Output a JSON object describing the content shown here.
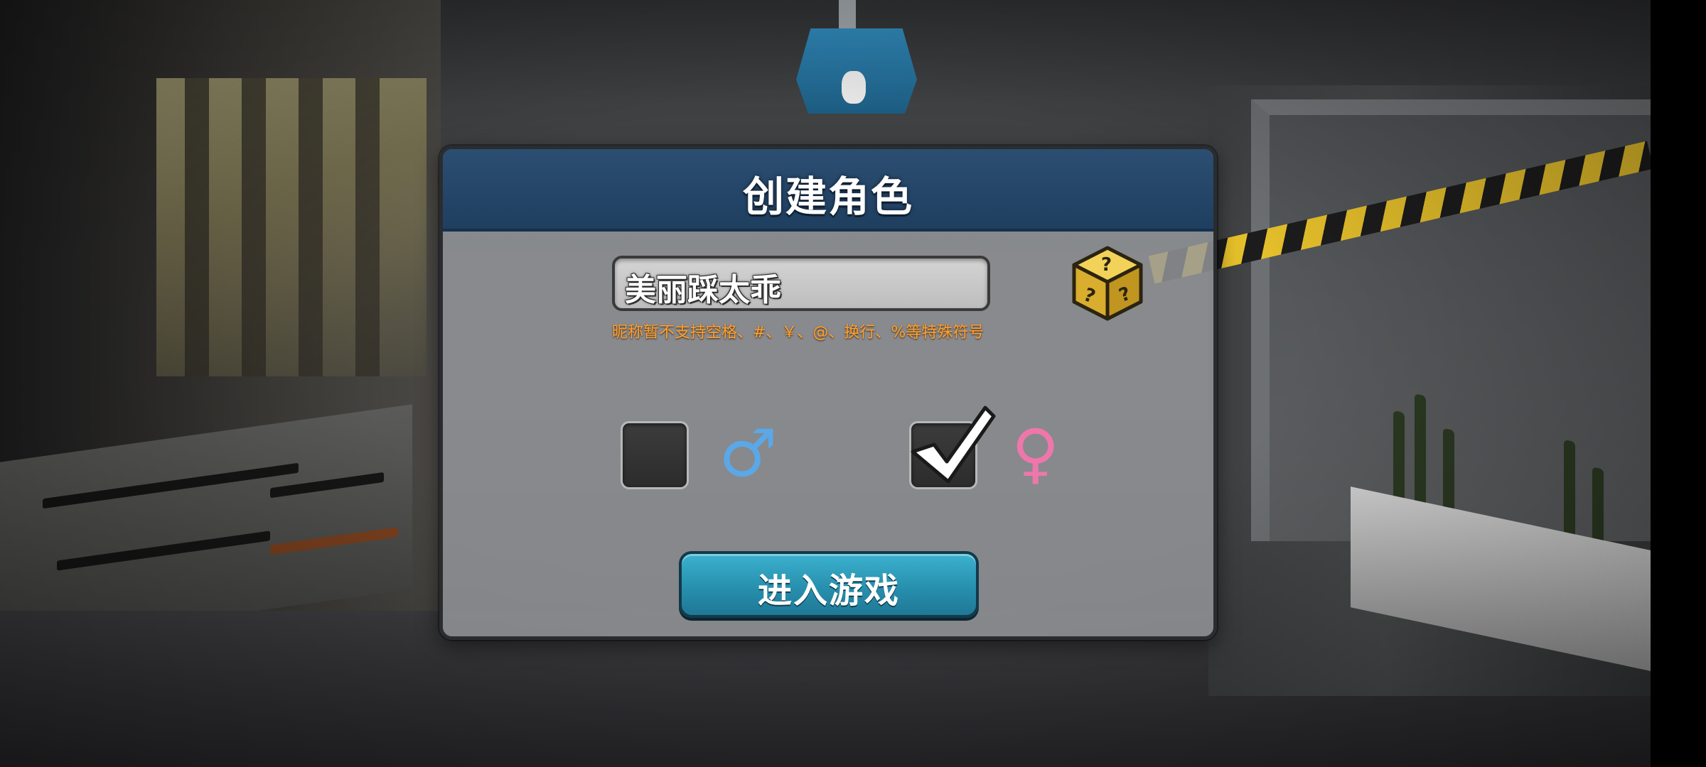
{
  "dialog": {
    "title": "创建角色",
    "name_value": "美丽踩太乖",
    "name_hint": "昵称暂不支持空格、#、￥、@、换行、%等特殊符号",
    "random_name_icon": "dice-question-icon",
    "gender": {
      "male_symbol": "♂",
      "female_symbol": "♀",
      "selected": "female"
    },
    "enter_button_label": "进入游戏"
  },
  "colors": {
    "header_blue": "#1f3f60",
    "hint_orange": "#ffa030",
    "male_blue": "#5aa8e8",
    "female_pink": "#ef76ab",
    "button_teal": "#2790ae",
    "dice_yellow": "#e7bf3e"
  }
}
